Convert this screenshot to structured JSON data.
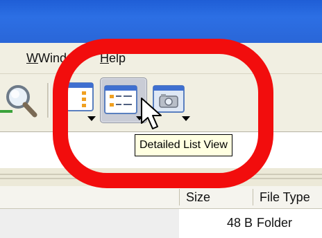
{
  "menubar": {
    "window_label_rest": "Windo",
    "window_mnemonic": "W",
    "help_mnemonic": "H",
    "help_label_rest": "elp"
  },
  "toolbar": {
    "buttons": [
      {
        "icon": "search-icon"
      },
      {
        "icon": "panel-view-icon"
      },
      {
        "icon": "detailed-list-view-icon",
        "pressed": true
      },
      {
        "icon": "thumbnail-view-icon"
      }
    ]
  },
  "tooltip": {
    "text": "Detailed List View"
  },
  "file_list": {
    "columns": [
      "Size",
      "File Type"
    ],
    "rows": [
      {
        "size": "48 B",
        "type": "Folder"
      }
    ]
  },
  "colors": {
    "highlight": "#f20d0d",
    "titlebar": "#2a66d8",
    "tooltip_bg": "#ffffe1"
  }
}
